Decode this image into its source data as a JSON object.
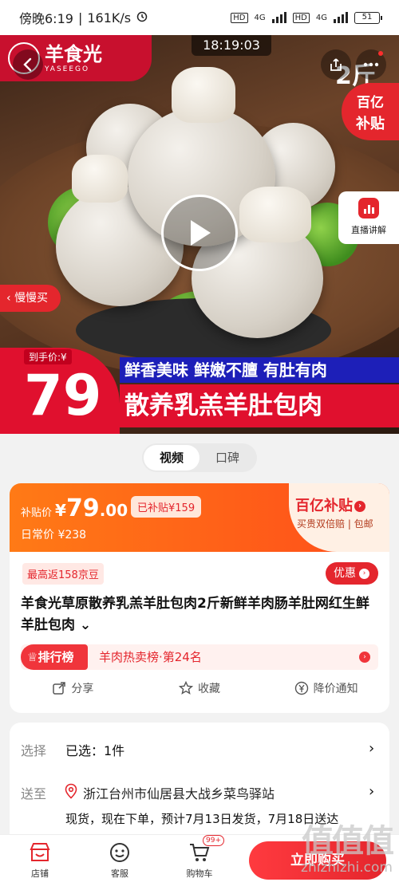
{
  "status_bar": {
    "time": "傍晚6:19",
    "speed": "161K/s",
    "network_1": "4G",
    "network_2": "4G",
    "battery": "51"
  },
  "hero": {
    "brand_name": "羊食光",
    "brand_sub": "YASEEGO",
    "timestamp": "18:19:03",
    "weight_tag": "2斤",
    "subsidy_badge_line1": "百亿",
    "subsidy_badge_line2": "补贴",
    "live_label": "直播讲解",
    "slow_buy": "慢慢买",
    "price_label": "到手价:¥",
    "price_value": "79",
    "slogan": "鲜香美味 鲜嫩不膻 有肚有肉",
    "title_strip": "散养乳羔羊肚包肉"
  },
  "tabs": [
    "视频",
    "口碑"
  ],
  "price_card": {
    "subsidy_label": "补贴价",
    "currency": "¥",
    "price_int": "79",
    "price_dec": ".00",
    "subsidized": "已补贴¥159",
    "normal_price": "日常价 ¥238",
    "program_name": "百亿补贴",
    "program_desc": "买贵双倍赔 | 包邮",
    "rebate": "最高返158京豆",
    "youhui": "优惠",
    "product_title": "羊食光草原散养乳羔羊肚包肉2斤新鲜羊肉肠羊肚网红生鲜羊肚包肉",
    "expand_arrow": "⌄",
    "rank_tag": "排行榜",
    "rank_text": "羊肉热卖榜·第24名",
    "actions": [
      "分享",
      "收藏",
      "降价通知"
    ]
  },
  "info": {
    "select_label": "选择",
    "select_value": "已选：1件",
    "ship_label": "送至",
    "ship_address": "浙江台州市仙居县大战乡菜鸟驿站",
    "ship_detail": "现货，现在下单，预计7月13日发货，7月18日送达"
  },
  "bottom_bar": {
    "store": "店铺",
    "service": "客服",
    "cart": "购物车",
    "cart_badge": "99+",
    "buy_now": "立即购买"
  },
  "watermark": {
    "zh": "值值值",
    "en": "zhizhizhi.com"
  },
  "colors": {
    "primary_red": "#e4262d",
    "orange": "#ff7a16",
    "slogan_blue": "#1d1fb8"
  }
}
